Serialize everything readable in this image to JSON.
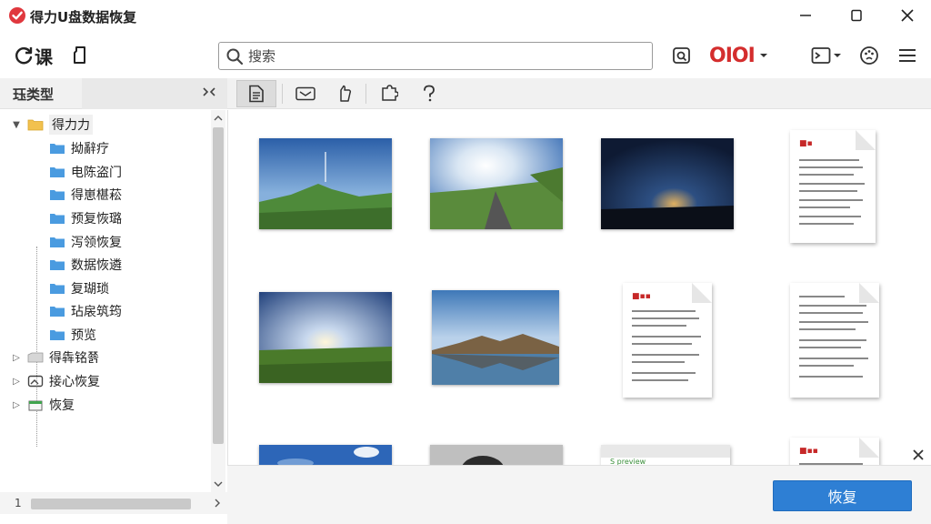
{
  "window": {
    "title": "得力U盘数据恢复",
    "minimize": "minimize",
    "maximize": "maximize",
    "close": "close"
  },
  "toolbar": {
    "left_label": "课",
    "search_placeholder": "搜索",
    "brand": "OIOI",
    "brand_color": "#d42d2d"
  },
  "left_panel": {
    "header": "珏类型",
    "tree": [
      {
        "label": "得力力",
        "level": 0,
        "expanded": true,
        "selected": true,
        "icon": "folder-open-icon"
      },
      {
        "label": "拗辭疗",
        "level": 1,
        "icon": "folder-icon"
      },
      {
        "label": "电陈盗门",
        "level": 1,
        "icon": "folder-icon"
      },
      {
        "label": "得崽椹菘",
        "level": 1,
        "icon": "folder-icon"
      },
      {
        "label": "预复恢璐",
        "level": 1,
        "icon": "folder-icon"
      },
      {
        "label": "泻领恢复",
        "level": 1,
        "icon": "folder-icon"
      },
      {
        "label": "数据恢遴",
        "level": 1,
        "icon": "folder-icon"
      },
      {
        "label": "复瑚琐",
        "level": 1,
        "icon": "folder-icon"
      },
      {
        "label": "玷扆筑筠",
        "level": 1,
        "icon": "folder-icon"
      },
      {
        "label": "预览",
        "level": 1,
        "icon": "folder-icon"
      },
      {
        "label": "得犇铭쬵",
        "level": 0,
        "expanded": false,
        "icon": "drive-icon"
      },
      {
        "label": "接心恢复",
        "level": 0,
        "expanded": false,
        "icon": "image-icon"
      },
      {
        "label": "恢复",
        "level": 0,
        "expanded": false,
        "icon": "green-box-icon"
      }
    ],
    "page_number": "1"
  },
  "content": {
    "items": [
      {
        "type": "photo",
        "name": "mountain-sky-photo",
        "colors": [
          "#2b5fa8",
          "#86b0dc",
          "#4e8a3a"
        ]
      },
      {
        "type": "photo",
        "name": "road-sun-photo",
        "colors": [
          "#3a6fb5",
          "#d9e6f3",
          "#5a8b3c"
        ]
      },
      {
        "type": "photo",
        "name": "sunset-sky-photo",
        "colors": [
          "#0e1a33",
          "#2d4f82",
          "#e0b060"
        ]
      },
      {
        "type": "document",
        "name": "document-1"
      },
      {
        "type": "photo",
        "name": "clouds-field-photo",
        "colors": [
          "#1f3f7a",
          "#c9d9ee",
          "#4a7a2a"
        ]
      },
      {
        "type": "photo",
        "name": "lake-reflection-photo",
        "colors": [
          "#3e78b8",
          "#b9d1ea",
          "#7a6244"
        ]
      },
      {
        "type": "document",
        "name": "document-2"
      },
      {
        "type": "document",
        "name": "document-3"
      },
      {
        "type": "photo",
        "name": "sky-partial-photo",
        "colors": [
          "#2d66b8",
          "#8fb4e0",
          "#ffffff"
        ]
      },
      {
        "type": "photo",
        "name": "person-partial-photo",
        "colors": [
          "#bfbfbf",
          "#333333",
          "#e8d9c8"
        ]
      },
      {
        "type": "window",
        "name": "window-partial",
        "text": "S preview"
      },
      {
        "type": "document",
        "name": "document-4"
      }
    ]
  },
  "bottom": {
    "restore_label": "恢复",
    "accent": "#2e7fd4"
  }
}
